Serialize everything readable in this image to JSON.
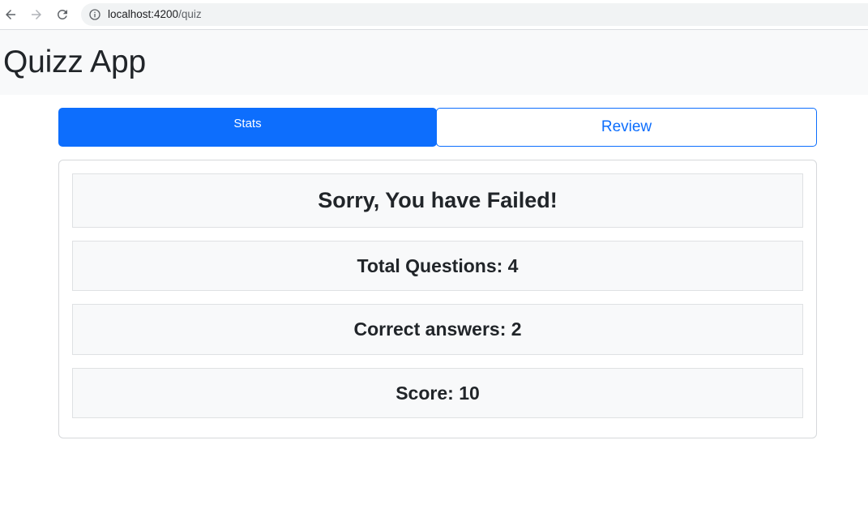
{
  "browser": {
    "url_host": "localhost:4200",
    "url_path": "/quiz"
  },
  "app": {
    "title": "Quizz App"
  },
  "tabs": [
    {
      "label": "Stats",
      "active": true
    },
    {
      "label": "Review",
      "active": false
    }
  ],
  "results": {
    "message": "Sorry, You have Failed!",
    "total_questions": "Total Questions: 4",
    "correct_answers": "Correct answers: 2",
    "score": "Score: 10"
  },
  "colors": {
    "primary": "#0d6efd",
    "header_bg": "#f8f9fa",
    "text": "#212529"
  }
}
